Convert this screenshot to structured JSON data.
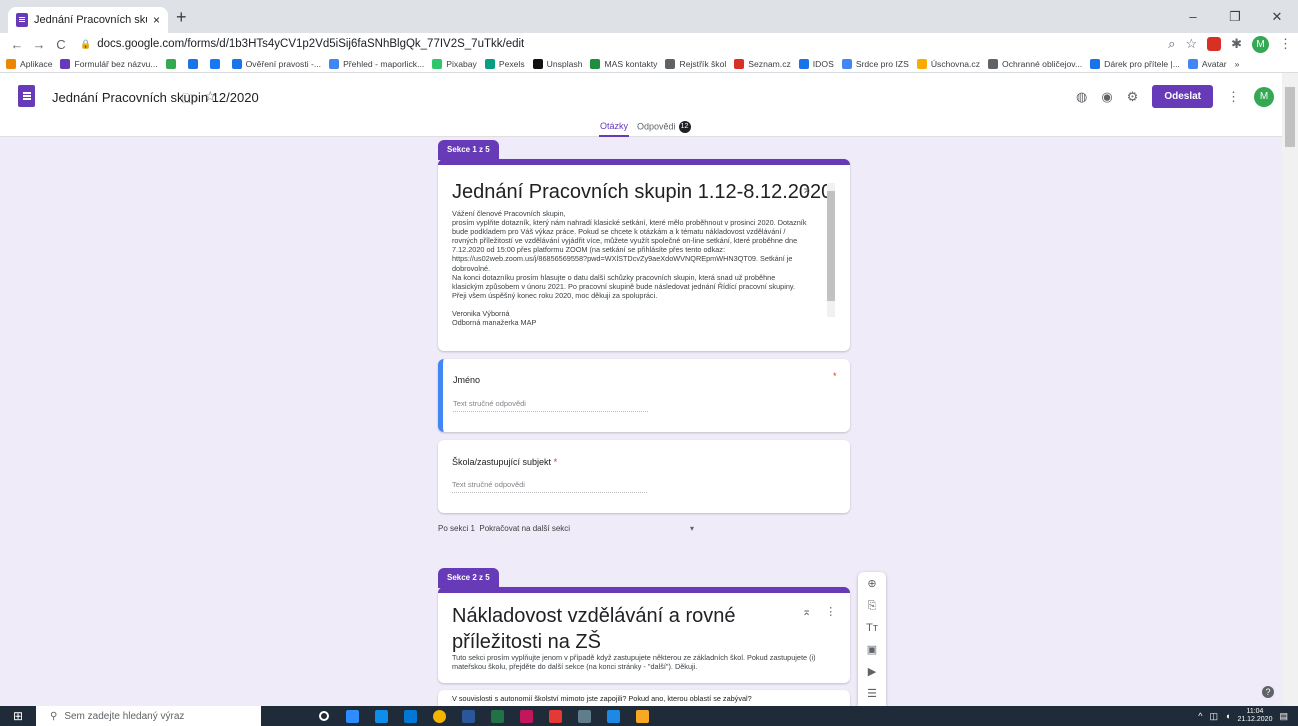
{
  "browser": {
    "tab_title": "Jednání Pracovních skupin 12/20",
    "tab_close": "×",
    "new_tab": "+",
    "url": "docs.google.com/forms/d/1b3HTs4yCV1p2Vd5iSij6faSNhBlgQk_77IV2S_7uTkk/edit",
    "window": {
      "minimize": "–",
      "maximize": "❐",
      "close": "✕"
    },
    "avatar_letter": "M",
    "bookmarks": [
      {
        "label": "Aplikace",
        "color": "#ea8600"
      },
      {
        "label": "Formulář bez názvu...",
        "color": "#673ab7"
      },
      {
        "label": "",
        "color": "#34a853"
      },
      {
        "label": "",
        "color": "#1a73e8"
      },
      {
        "label": "",
        "color": "#1877f2"
      },
      {
        "label": "Ověření pravosti -...",
        "color": "#1a73e8"
      },
      {
        "label": "Přehled - maporlick...",
        "color": "#4285f4"
      },
      {
        "label": "Pixabay",
        "color": "#2ec66d"
      },
      {
        "label": "Pexels",
        "color": "#05a081"
      },
      {
        "label": "Unsplash",
        "color": "#111111"
      },
      {
        "label": "MAS kontakty",
        "color": "#1e8e3e"
      },
      {
        "label": "Rejstřík škol",
        "color": "#5f6368"
      },
      {
        "label": "Seznam.cz",
        "color": "#d93025"
      },
      {
        "label": "IDOS",
        "color": "#1a73e8"
      },
      {
        "label": "Srdce pro IZS",
        "color": "#4285f4"
      },
      {
        "label": "Úschovna.cz",
        "color": "#f9ab00"
      },
      {
        "label": "Ochranné obličejov...",
        "color": "#5f6368"
      },
      {
        "label": "Dárek pro přítele |...",
        "color": "#1a73e8"
      },
      {
        "label": "Avatar",
        "color": "#4285f4"
      }
    ],
    "bookmarks_more": "»"
  },
  "app": {
    "doc_title": "Jednání Pracovních skupin 12/2020",
    "send_label": "Odeslat",
    "tab_questions": "Otázky",
    "tab_responses": "Odpovědi",
    "responses_count": "12",
    "avatar_letter": "M"
  },
  "section1": {
    "label": "Sekce 1 z 5",
    "title": "Jednání Pracovních skupin 1.12-8.12.2020",
    "description": "Vážení členové Pracovních skupin,\nprosím vyplňte dotazník, který nám nahradí klasické setkání, které mělo proběhnout v prosinci 2020. Dotazník\nbude podkladem pro Váš výkaz práce. Pokud se chcete k otázkám a k tématu nákladovost vzdělávání /\nrovných příležitostí ve vzdělávání vyjádřit více, můžete využít společné on-line setkání, které proběhne dne\n7.12.2020 od 15:00 přes platformu ZOOM (na setkání se přihlásíte přes tento odkaz:\nhttps://us02web.zoom.us/j/86856569558?pwd=WXlSTDcvZy9aeXdoWVNQREpmWHN3QT09. Setkání je\ndobrovolné.\nNa konci dotazníku prosím hlasujte o datu další schůzky pracovních skupin, která snad už proběhne\nklasickým způsobem v únoru 2021. Po pracovní skupině bude následovat jednání Řídící pracovní skupiny.\nPřeji všem úspěšný konec roku 2020, moc děkuji za spolupráci.\n\nVeronika Výborná\nOdborná manažerka MAP",
    "questions": [
      {
        "label": "Jméno",
        "required": "*",
        "placeholder": "Text stručné odpovědi"
      },
      {
        "label": "Škola/zastupující subjekt",
        "required": "*",
        "placeholder": "Text stručné odpovědi"
      }
    ],
    "after_label": "Po sekci 1",
    "after_value": "Pokračovat na další sekci"
  },
  "section2": {
    "label": "Sekce 2 z 5",
    "title": "Nákladovost vzdělávání  a rovné příležitosti na ZŠ",
    "description": "Tuto sekci prosím vyplňujte jenom v případě když zastupujete některou ze základních škol. Pokud zastupujete (i)\nmateřskou školu, přejděte do další sekce (na konci stránky - \"další\"). Děkuji.",
    "next_snippet": "V souvislosti s autonomií školství mimoto jste zapojili? Pokud ano, kterou oblastí se zabýval?"
  },
  "taskbar": {
    "search_placeholder": "Sem zadejte hledaný výraz",
    "time": "11:04",
    "date": "21.12.2020",
    "icons": [
      {
        "name": "task-view-icon",
        "color": "#ffffff"
      },
      {
        "name": "zoom-app-icon",
        "color": "#2d8cff"
      },
      {
        "name": "teamviewer-icon",
        "color": "#0e8ee9"
      },
      {
        "name": "outlook-icon",
        "color": "#0078d4"
      },
      {
        "name": "chrome-icon",
        "color": "#f4b400"
      },
      {
        "name": "word-icon",
        "color": "#2b579a"
      },
      {
        "name": "excel-icon",
        "color": "#217346"
      },
      {
        "name": "paint-icon",
        "color": "#c2185b"
      },
      {
        "name": "app-icon-red",
        "color": "#e53935"
      },
      {
        "name": "calculator-icon",
        "color": "#607d8b"
      },
      {
        "name": "installer-icon",
        "color": "#1e88e5"
      },
      {
        "name": "file-explorer-icon",
        "color": "#f9a825"
      }
    ]
  }
}
